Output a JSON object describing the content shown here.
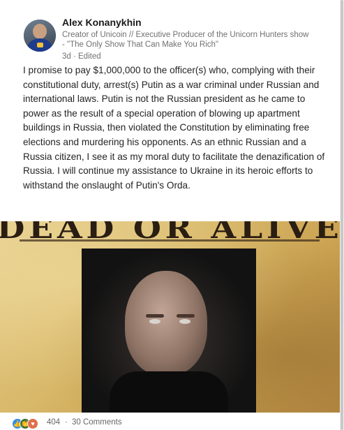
{
  "author": {
    "name": "Alex Konanykhin",
    "headline": "Creator of Unicoin // Executive Producer of the Unicorn Hunters show - \"The Only Show That Can Make You Rich\"",
    "meta": "3d · Edited"
  },
  "post": {
    "text": "I promise to pay $1,000,000 to the officer(s) who, complying with their constitutional duty, arrest(s) Putin as a war criminal under Russian and international laws. Putin is not the Russian president as he came to power as the result of a special operation of blowing up apartment buildings in Russia, then violated the Constitution by eliminating free elections and murdering his opponents. As an ethnic Russian and a Russia citizen, I see it as my moral duty to facilitate the denazification of Russia. I will continue my assistance to Ukraine in its heroic efforts to withstand the onslaught of Putin's Orda.",
    "image_caption_text": "DEAD OR ALIVE"
  },
  "social": {
    "reaction_count": "404",
    "separator": "·",
    "comments": "30 Comments",
    "reaction_icons": [
      "like-icon",
      "celebrate-icon",
      "love-icon"
    ]
  },
  "colors": {
    "like": "#378fe9",
    "celebrate": "#44712e",
    "love": "#df704d",
    "text": "#242424",
    "secondary": "#707070"
  }
}
